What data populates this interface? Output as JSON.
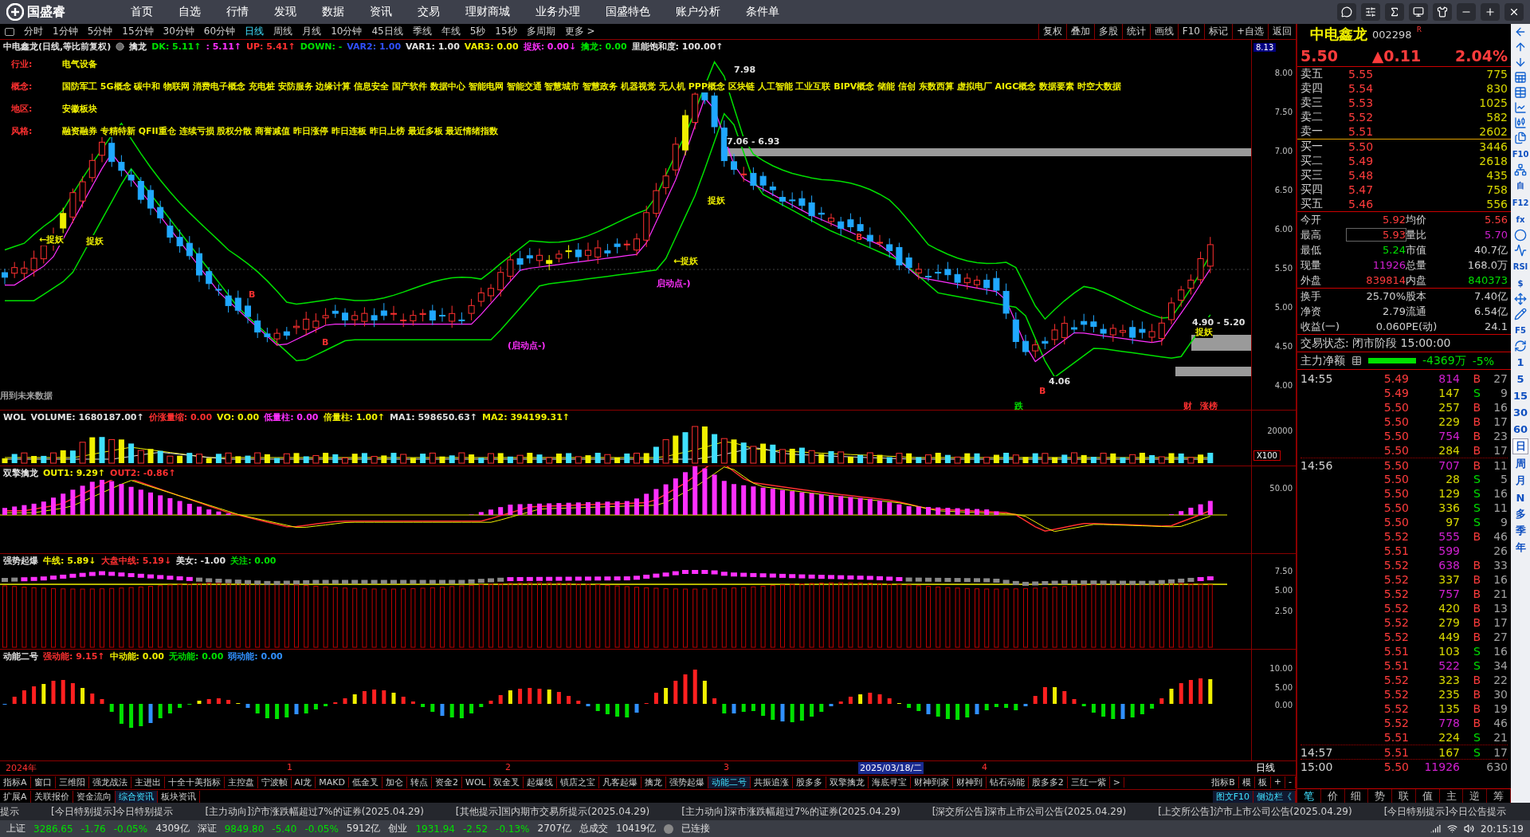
{
  "app": {
    "brand": "国盛睿",
    "menu": [
      "首页",
      "自选",
      "行情",
      "发现",
      "数据",
      "资讯",
      "交易",
      "理财商城",
      "业务办理",
      "国盛特色",
      "账户分析",
      "条件单"
    ]
  },
  "periods": [
    {
      "label": "分时",
      "selected": false
    },
    {
      "label": "1分钟",
      "selected": false
    },
    {
      "label": "5分钟",
      "selected": false
    },
    {
      "label": "15分钟",
      "selected": false
    },
    {
      "label": "30分钟",
      "selected": false
    },
    {
      "label": "60分钟",
      "selected": false
    },
    {
      "label": "日线",
      "selected": true
    },
    {
      "label": "周线",
      "selected": false
    },
    {
      "label": "月线",
      "selected": false
    },
    {
      "label": "10分钟",
      "selected": false
    },
    {
      "label": "45日线",
      "selected": false
    },
    {
      "label": "季线",
      "selected": false
    },
    {
      "label": "年线",
      "selected": false
    },
    {
      "label": "5秒",
      "selected": false
    },
    {
      "label": "15秒",
      "selected": false
    },
    {
      "label": "多周期",
      "selected": false
    },
    {
      "label": "更多 >",
      "selected": false
    }
  ],
  "chart_tools": [
    "复权",
    "叠加",
    "多股",
    "统计",
    "画线",
    "F10",
    "标记",
    "+自选",
    "返回"
  ],
  "main_chart": {
    "title": "中电鑫龙(日线,等比前复权)",
    "formula": "擒龙",
    "values": [
      {
        "text": "DK: 5.11↑",
        "color": "#00e000"
      },
      {
        "text": ": 5.11↑",
        "color": "#ff30ff"
      },
      {
        "text": "UP: 5.41↑",
        "color": "#ff3030"
      },
      {
        "text": "DOWN: -",
        "color": "#00e000"
      },
      {
        "text": "VAR2: 1.00",
        "color": "#3050ff"
      },
      {
        "text": "VAR1: 1.00",
        "color": "#e0e0e0"
      },
      {
        "text": "VAR3: 0.00",
        "color": "#f0f000"
      },
      {
        "text": "捉妖: 0.00↓",
        "color": "#ff30ff"
      },
      {
        "text": "擒龙: 0.00",
        "color": "#00e000"
      },
      {
        "text": "里能饱和度: 100.00↑",
        "color": "#e0e0e0"
      }
    ],
    "info": [
      {
        "label": "行业:",
        "value": "电气设备"
      },
      {
        "label": "概念:",
        "value": "国防军工 5G概念 碳中和 物联网 消费电子概念 充电桩 安防服务 边缘计算 信息安全 国产软件 数据中心 智能电网 智能交通 智慧城市 智慧政务 机器视觉 无人机 PPP概念 区块链 人工智能 工业互联 BIPV概念 储能 信创 东数西算 虚拟电厂 AIGC概念 数据要素 时空大数据"
      },
      {
        "label": "地区:",
        "value": "安徽板块"
      },
      {
        "label": "风格:",
        "value": "融资融券 专精特新 QFII重仓 连续亏损 股权分散 商誉减值 昨日涨停 昨日连板 昨日上榜 最近多板 最近情绪指数"
      }
    ],
    "marks": [
      {
        "text": "7.98",
        "kind": "level"
      },
      {
        "text": "7.06 - 6.93",
        "kind": "level"
      },
      {
        "text": "4.06",
        "kind": "level"
      },
      {
        "text": "4.90 - 5.20",
        "kind": "level"
      },
      {
        "text": "←捉妖",
        "kind": "signal"
      },
      {
        "text": "捉妖",
        "kind": "signal"
      },
      {
        "text": "←捉妖",
        "kind": "signal"
      },
      {
        "text": "捉妖",
        "kind": "signal"
      },
      {
        "text": "捉妖",
        "kind": "signal"
      },
      {
        "text": "启动点-)",
        "kind": "start"
      },
      {
        "text": "(启动点-)",
        "kind": "start"
      },
      {
        "text": "B",
        "kind": "buy"
      },
      {
        "text": "B",
        "kind": "buy"
      },
      {
        "text": "B",
        "kind": "buy"
      },
      {
        "text": "B",
        "kind": "buy"
      },
      {
        "text": "用到未来数据",
        "kind": "note"
      },
      {
        "text": "跌",
        "kind": "fall"
      },
      {
        "text": "财",
        "kind": "buy"
      },
      {
        "text": "涨榜",
        "kind": "buy"
      }
    ],
    "high_tag": "8.13",
    "axis": [
      "8.00",
      "7.50",
      "7.00",
      "6.50",
      "6.00",
      "5.50",
      "5.00",
      "4.50",
      "4.00"
    ]
  },
  "panels": [
    {
      "kind": "volume",
      "name": "WOL",
      "values": [
        {
          "text": "VOLUME: 1680187.00↑",
          "color": "#e0e0e0"
        },
        {
          "text": "价涨量缩: 0.00",
          "color": "#ff3030"
        },
        {
          "text": "VO: 0.00",
          "color": "#f0f000"
        },
        {
          "text": "低量柱: 0.00",
          "color": "#ff30ff"
        },
        {
          "text": "倍量柱: 1.00↑",
          "color": "#f0f000"
        },
        {
          "text": "MA1: 598650.63↑",
          "color": "#e0e0e0"
        },
        {
          "text": "MA2: 394199.31↑",
          "color": "#f0f000"
        }
      ],
      "axis": [
        "20000"
      ],
      "unit": "X100"
    },
    {
      "kind": "dual",
      "name": "双擎擒龙",
      "values": [
        {
          "text": "OUT1: 9.29↑",
          "color": "#f0f000"
        },
        {
          "text": "OUT2: -0.86↑",
          "color": "#ff3030"
        }
      ],
      "axis": [
        "50.00"
      ]
    },
    {
      "kind": "strong",
      "name": "强势起爆",
      "values": [
        {
          "text": "牛线: 5.89↓",
          "color": "#f0f000"
        },
        {
          "text": "大盘中线: 5.19↓",
          "color": "#ff3030"
        },
        {
          "text": "美女: -1.00",
          "color": "#e0e0e0"
        },
        {
          "text": "关注: 0.00",
          "color": "#00e000"
        }
      ],
      "axis": [
        "7.50",
        "5.00",
        "2.50"
      ]
    },
    {
      "kind": "momentum",
      "name": "动能二号",
      "values": [
        {
          "text": "强动能: 9.15↑",
          "color": "#ff3030"
        },
        {
          "text": "中动能: 0.00",
          "color": "#f0f000"
        },
        {
          "text": "无动能: 0.00",
          "color": "#00e000"
        },
        {
          "text": "弱动能: 0.00",
          "color": "#3090ff"
        }
      ],
      "axis": [
        "10.00",
        "5.00",
        "0.00"
      ]
    }
  ],
  "date_axis": [
    {
      "text": "2024年",
      "selected": false
    },
    {
      "text": "1",
      "selected": false
    },
    {
      "text": "2",
      "selected": false
    },
    {
      "text": "3",
      "selected": false
    },
    {
      "text": "2025/03/18/二",
      "selected": true
    },
    {
      "text": "4",
      "selected": false
    }
  ],
  "date_axis_unit": "日线",
  "indicator_tabs": [
    {
      "label": "指标A",
      "selected": false
    },
    {
      "label": "窗口",
      "selected": false
    },
    {
      "label": "三维阳",
      "selected": false
    },
    {
      "label": "强龙战法",
      "selected": false
    },
    {
      "label": "主进出",
      "selected": false
    },
    {
      "label": "十全十美指标",
      "selected": false
    },
    {
      "label": "主控盘",
      "selected": false
    },
    {
      "label": "宁波帧",
      "selected": false
    },
    {
      "label": "AI龙",
      "selected": false
    },
    {
      "label": "MAKD",
      "selected": false
    },
    {
      "label": "低金叉",
      "selected": false
    },
    {
      "label": "加仑",
      "selected": false
    },
    {
      "label": "转点",
      "selected": false
    },
    {
      "label": "资金2",
      "selected": false
    },
    {
      "label": "WOL",
      "selected": false
    },
    {
      "label": "双金叉",
      "selected": false
    },
    {
      "label": "起爆线",
      "selected": false
    },
    {
      "label": "镇店之宝",
      "selected": false
    },
    {
      "label": "凡客起爆",
      "selected": false
    },
    {
      "label": "擒龙",
      "selected": false
    },
    {
      "label": "强势起爆",
      "selected": false
    },
    {
      "label": "动能二号",
      "selected": true
    },
    {
      "label": "共振追涨",
      "selected": false
    },
    {
      "label": "股多多",
      "selected": false
    },
    {
      "label": "双擎擒龙",
      "selected": false
    },
    {
      "label": "海底寻宝",
      "selected": false
    },
    {
      "label": "财神到家",
      "selected": false
    },
    {
      "label": "财神到",
      "selected": false
    },
    {
      "label": "钻石动能",
      "selected": false
    },
    {
      "label": "股多多2",
      "selected": false
    },
    {
      "label": "三红一紫",
      "selected": false
    },
    {
      "label": ">",
      "selected": false
    }
  ],
  "indicator_tabs_right": [
    "指标B",
    "模",
    "板",
    "+",
    "-"
  ],
  "extra_tabs": [
    {
      "label": "扩展A",
      "selected": false
    },
    {
      "label": "关联报价",
      "selected": false
    },
    {
      "label": "资金流向",
      "selected": false
    },
    {
      "label": "综合资讯",
      "selected": true
    },
    {
      "label": "板块资讯",
      "selected": false
    }
  ],
  "extra_right": [
    "图文F10",
    "侧边栏《"
  ],
  "quote": {
    "name": "中电鑫龙",
    "code": "002298",
    "flag": "R",
    "price": "5.50",
    "change": "▲0.11",
    "percent": "2.04%",
    "asks": [
      {
        "label": "卖五",
        "price": "5.55",
        "volume": "775"
      },
      {
        "label": "卖四",
        "price": "5.54",
        "volume": "830"
      },
      {
        "label": "卖三",
        "price": "5.53",
        "volume": "1025"
      },
      {
        "label": "卖二",
        "price": "5.52",
        "volume": "582"
      },
      {
        "label": "卖一",
        "price": "5.51",
        "volume": "2602"
      }
    ],
    "bids": [
      {
        "label": "买一",
        "price": "5.50",
        "volume": "3446"
      },
      {
        "label": "买二",
        "price": "5.49",
        "volume": "2618"
      },
      {
        "label": "买三",
        "price": "5.48",
        "volume": "435"
      },
      {
        "label": "买四",
        "price": "5.47",
        "volume": "758"
      },
      {
        "label": "买五",
        "price": "5.46",
        "volume": "556"
      }
    ],
    "stats": [
      {
        "left": {
          "label": "今开",
          "value": "5.92",
          "color": "#ff3c3c",
          "boxed": false
        },
        "right": {
          "label": "均价",
          "value": "5.56",
          "color": "#ff3c3c",
          "boxed": false
        }
      },
      {
        "left": {
          "label": "最高",
          "value": "5.93",
          "color": "#ff3c3c",
          "boxed": true
        },
        "right": {
          "label": "量比",
          "value": "5.70",
          "color": "#d020d0",
          "boxed": false
        }
      },
      {
        "left": {
          "label": "最低",
          "value": "5.24",
          "color": "#00e000",
          "boxed": false
        },
        "right": {
          "label": "市值",
          "value": "40.7亿",
          "color": "#d0d0d0",
          "boxed": false
        }
      },
      {
        "left": {
          "label": "现量",
          "value": "11926",
          "color": "#d020d0",
          "boxed": false
        },
        "right": {
          "label": "总量",
          "value": "168.0万",
          "color": "#d0d0d0",
          "boxed": false
        }
      },
      {
        "left": {
          "label": "外盘",
          "value": "839814",
          "color": "#ff3c3c",
          "boxed": false
        },
        "right": {
          "label": "内盘",
          "value": "840373",
          "color": "#00e000",
          "boxed": false
        }
      }
    ],
    "stats2": [
      {
        "label": "换手",
        "value": "25.70%",
        "label2": "股本",
        "value2": "7.40亿"
      },
      {
        "label": "净资",
        "value": "2.79",
        "label2": "流通",
        "value2": "6.54亿"
      },
      {
        "label": "收益(一)",
        "value": "0.060",
        "label2": "PE(动)",
        "value2": "24.1"
      }
    ],
    "status": "交易状态: 闭市阶段 15:00:00",
    "flow_label": "主力净额",
    "flow_value": "-4369万",
    "flow_percent": "-5%"
  },
  "ticks": [
    {
      "time": "14:55",
      "price": "5.49",
      "volume": "814",
      "big": true,
      "side": "B",
      "count": "27"
    },
    {
      "price": "5.49",
      "volume": "147",
      "big": false,
      "side": "S",
      "count": "9"
    },
    {
      "price": "5.50",
      "volume": "257",
      "big": false,
      "side": "B",
      "count": "16"
    },
    {
      "price": "5.50",
      "volume": "229",
      "big": false,
      "side": "B",
      "count": "17"
    },
    {
      "price": "5.50",
      "volume": "754",
      "big": true,
      "side": "B",
      "count": "23"
    },
    {
      "price": "5.50",
      "volume": "284",
      "big": false,
      "side": "B",
      "count": "17"
    },
    {
      "time": "14:56",
      "price": "5.50",
      "volume": "707",
      "big": true,
      "side": "B",
      "count": "11"
    },
    {
      "price": "5.50",
      "volume": "28",
      "big": false,
      "side": "S",
      "count": "5"
    },
    {
      "price": "5.50",
      "volume": "129",
      "big": false,
      "side": "S",
      "count": "16"
    },
    {
      "price": "5.50",
      "volume": "336",
      "big": false,
      "side": "S",
      "count": "11"
    },
    {
      "price": "5.50",
      "volume": "97",
      "big": false,
      "side": "S",
      "count": "9"
    },
    {
      "price": "5.52",
      "volume": "555",
      "big": true,
      "side": "B",
      "count": "46"
    },
    {
      "price": "5.51",
      "volume": "599",
      "big": true,
      "count": "26"
    },
    {
      "price": "5.52",
      "volume": "638",
      "big": true,
      "side": "B",
      "count": "33"
    },
    {
      "price": "5.52",
      "volume": "337",
      "big": false,
      "side": "B",
      "count": "16"
    },
    {
      "price": "5.52",
      "volume": "757",
      "big": true,
      "side": "B",
      "count": "21"
    },
    {
      "price": "5.52",
      "volume": "420",
      "big": false,
      "side": "B",
      "count": "13"
    },
    {
      "price": "5.52",
      "volume": "279",
      "big": false,
      "side": "B",
      "count": "17"
    },
    {
      "price": "5.52",
      "volume": "449",
      "big": false,
      "side": "B",
      "count": "27"
    },
    {
      "price": "5.51",
      "volume": "103",
      "big": false,
      "side": "S",
      "count": "16"
    },
    {
      "price": "5.51",
      "volume": "522",
      "big": true,
      "side": "S",
      "count": "34"
    },
    {
      "price": "5.52",
      "volume": "323",
      "big": false,
      "side": "B",
      "count": "22"
    },
    {
      "price": "5.52",
      "volume": "235",
      "big": false,
      "side": "B",
      "count": "30"
    },
    {
      "price": "5.52",
      "volume": "135",
      "big": false,
      "side": "B",
      "count": "19"
    },
    {
      "price": "5.52",
      "volume": "778",
      "big": true,
      "side": "B",
      "count": "46"
    },
    {
      "price": "5.51",
      "volume": "224",
      "big": false,
      "side": "S",
      "count": "21"
    },
    {
      "time": "14:57",
      "price": "5.51",
      "volume": "167",
      "big": false,
      "side": "S",
      "count": "17"
    },
    {
      "time": "15:00",
      "price": "5.50",
      "volume": "11926",
      "big": true,
      "count": "630"
    }
  ],
  "quote_tabs": [
    {
      "label": "笔",
      "selected": true
    },
    {
      "label": "价",
      "selected": false
    },
    {
      "label": "细",
      "selected": false
    },
    {
      "label": "势",
      "selected": false
    },
    {
      "label": "联",
      "selected": false
    },
    {
      "label": "值",
      "selected": false
    },
    {
      "label": "主",
      "selected": false
    },
    {
      "label": "逆",
      "selected": false
    },
    {
      "label": "筹",
      "selected": false
    }
  ],
  "side_tools": [
    {
      "kind": "icon"
    },
    {
      "kind": "icon"
    },
    {
      "kind": "icon"
    },
    {
      "kind": "icon"
    },
    {
      "kind": "icon"
    },
    {
      "kind": "icon"
    },
    {
      "kind": "icon"
    },
    {
      "kind": "icon"
    },
    {
      "kind": "label",
      "text": "F10"
    },
    {
      "kind": "icon"
    },
    {
      "kind": "label",
      "text": "自"
    },
    {
      "kind": "label",
      "text": "F12"
    },
    {
      "kind": "label",
      "text": "fx"
    },
    {
      "kind": "icon"
    },
    {
      "kind": "icon"
    },
    {
      "kind": "label",
      "text": "RSI"
    },
    {
      "kind": "label",
      "text": "$"
    },
    {
      "kind": "icon"
    },
    {
      "kind": "icon"
    },
    {
      "kind": "label",
      "text": "F5"
    },
    {
      "kind": "icon"
    }
  ],
  "side_periods": [
    {
      "label": "1",
      "selected": false
    },
    {
      "label": "5",
      "selected": false
    },
    {
      "label": "15",
      "selected": false
    },
    {
      "label": "30",
      "selected": false
    },
    {
      "label": "60",
      "selected": false
    },
    {
      "label": "日",
      "selected": true
    },
    {
      "label": "周",
      "selected": false
    },
    {
      "label": "月",
      "selected": false
    },
    {
      "label": "N",
      "selected": false
    },
    {
      "label": "多",
      "selected": false
    },
    {
      "label": "季",
      "selected": false
    },
    {
      "label": "年",
      "selected": false
    }
  ],
  "ticker": [
    "提示",
    "[今日特别提示]今日特别提示",
    "[主力动向]沪市涨跌幅超过7%的证券(2025.04.29)",
    "[其他提示]国内期市交易所提示(2025.04.29)",
    "[主力动向]深市涨跌幅超过7%的证券(2025.04.29)",
    "[深交所公告]深市上市公司公告(2025.04.29)",
    "[上交所公告]沪市上市公司公告(2025.04.29)",
    "[今日特别提示]今日公告提示"
  ],
  "indices": [
    {
      "name": "上证",
      "value": "3286.65",
      "change": "-1.76",
      "percent": "-0.05%",
      "amount": "4309亿"
    },
    {
      "name": "深证",
      "value": "9849.80",
      "change": "-5.40",
      "percent": "-0.05%",
      "amount": "5912亿"
    },
    {
      "name": "创业",
      "value": "1931.94",
      "change": "-2.52",
      "percent": "-0.13%",
      "amount": "2707亿"
    }
  ],
  "total_label": "总成交",
  "total_value": "10419亿",
  "connection": "已连接",
  "clock": "20:15:19"
}
